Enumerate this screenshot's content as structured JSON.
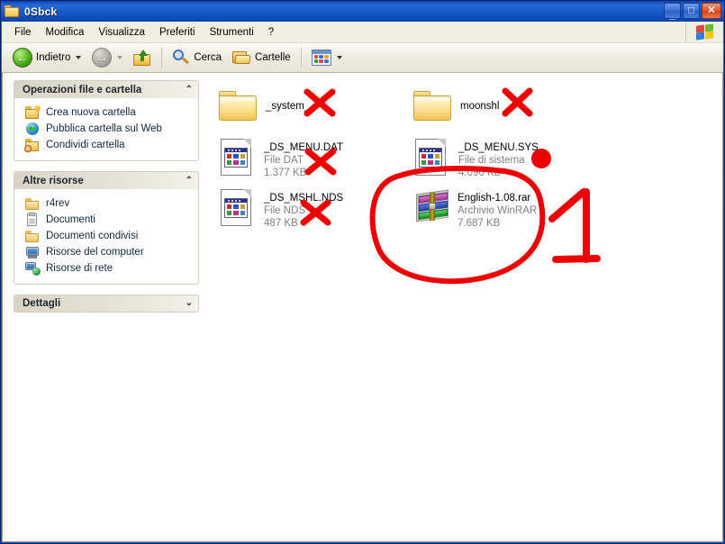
{
  "window": {
    "title": "0Sbck",
    "title_icon": "folder-icon",
    "controls": {
      "minimize": "_",
      "maximize": "□",
      "close": "✕"
    }
  },
  "menubar": {
    "items": [
      {
        "label": "File",
        "name": "menu-file"
      },
      {
        "label": "Modifica",
        "name": "menu-modifica"
      },
      {
        "label": "Visualizza",
        "name": "menu-visualizza"
      },
      {
        "label": "Preferiti",
        "name": "menu-preferiti"
      },
      {
        "label": "Strumenti",
        "name": "menu-strumenti"
      },
      {
        "label": "?",
        "name": "menu-help"
      }
    ],
    "brand_icon": "windows-flag-icon"
  },
  "toolbar": {
    "back_label": "Indietro",
    "back_icon": "back-arrow-icon",
    "forward_icon": "forward-arrow-icon",
    "up_icon": "up-folder-icon",
    "search_label": "Cerca",
    "search_icon": "search-magnifier-icon",
    "folders_label": "Cartelle",
    "folders_icon": "folders-icon",
    "views_icon": "views-grid-icon"
  },
  "sidebar": {
    "panels": [
      {
        "title": "Operazioni file e cartella",
        "name": "panel-file-folder-tasks",
        "collapsed": false,
        "chevron": "⌃",
        "items": [
          {
            "label": "Crea nuova cartella",
            "icon": "new-folder-icon",
            "name": "sidebar-item-new-folder"
          },
          {
            "label": "Pubblica cartella sul Web",
            "icon": "publish-web-icon",
            "name": "sidebar-item-publish-web"
          },
          {
            "label": "Condividi cartella",
            "icon": "share-folder-icon",
            "name": "sidebar-item-share-folder"
          }
        ]
      },
      {
        "title": "Altre risorse",
        "name": "panel-other-places",
        "collapsed": false,
        "chevron": "⌃",
        "items": [
          {
            "label": "r4rev",
            "icon": "folder-icon",
            "name": "sidebar-item-r4rev"
          },
          {
            "label": "Documenti",
            "icon": "documents-icon",
            "name": "sidebar-item-documenti"
          },
          {
            "label": "Documenti condivisi",
            "icon": "folder-icon",
            "name": "sidebar-item-documenti-condivisi"
          },
          {
            "label": "Risorse del computer",
            "icon": "my-computer-icon",
            "name": "sidebar-item-risorse-computer"
          },
          {
            "label": "Risorse di rete",
            "icon": "network-icon",
            "name": "sidebar-item-risorse-rete"
          }
        ]
      },
      {
        "title": "Dettagli",
        "name": "panel-details",
        "collapsed": true,
        "chevron": "⌄",
        "items": []
      }
    ]
  },
  "files": [
    {
      "name": "_system_",
      "type": "folder",
      "icon": "folder-icon",
      "meta1": "",
      "meta2": "",
      "data_name": "file-item-system"
    },
    {
      "name": "moonshl",
      "type": "folder",
      "icon": "folder-icon",
      "meta1": "",
      "meta2": "",
      "data_name": "file-item-moonshl"
    },
    {
      "name": "_DS_MENU.DAT",
      "type": "file",
      "icon": "generic-file-icon",
      "meta1": "File DAT",
      "meta2": "1.377 KB",
      "data_name": "file-item-ds-menu-dat"
    },
    {
      "name": "_DS_MENU.SYS",
      "type": "file",
      "icon": "generic-file-icon",
      "meta1": "File di sistema",
      "meta2": "4.096 KB",
      "data_name": "file-item-ds-menu-sys"
    },
    {
      "name": "_DS_MSHL.NDS",
      "type": "file",
      "icon": "generic-file-icon",
      "meta1": "File NDS",
      "meta2": "487 KB",
      "data_name": "file-item-ds-mshl-nds"
    },
    {
      "name": "English-1.08.rar",
      "type": "archive",
      "icon": "winrar-archive-icon",
      "meta1": "Archivio WinRAR",
      "meta2": "7.687 KB",
      "data_name": "file-item-english-rar"
    }
  ],
  "annotations": {
    "color": "#ee0000",
    "marks": [
      {
        "kind": "cross",
        "name": "annotation-cross-system",
        "target": "_system_"
      },
      {
        "kind": "cross",
        "name": "annotation-cross-moonshl",
        "target": "moonshl"
      },
      {
        "kind": "cross",
        "name": "annotation-cross-ds-menu-dat",
        "target": "_DS_MENU.DAT"
      },
      {
        "kind": "cross",
        "name": "annotation-cross-ds-mshl-nds",
        "target": "_DS_MSHL.NDS"
      },
      {
        "kind": "dot",
        "name": "annotation-dot-ds-menu-sys",
        "target": "_DS_MENU.SYS"
      },
      {
        "kind": "circle",
        "name": "annotation-circle-english-rar",
        "target": "English-1.08.rar"
      },
      {
        "kind": "digit",
        "name": "annotation-digit-one",
        "label": "1"
      }
    ]
  }
}
